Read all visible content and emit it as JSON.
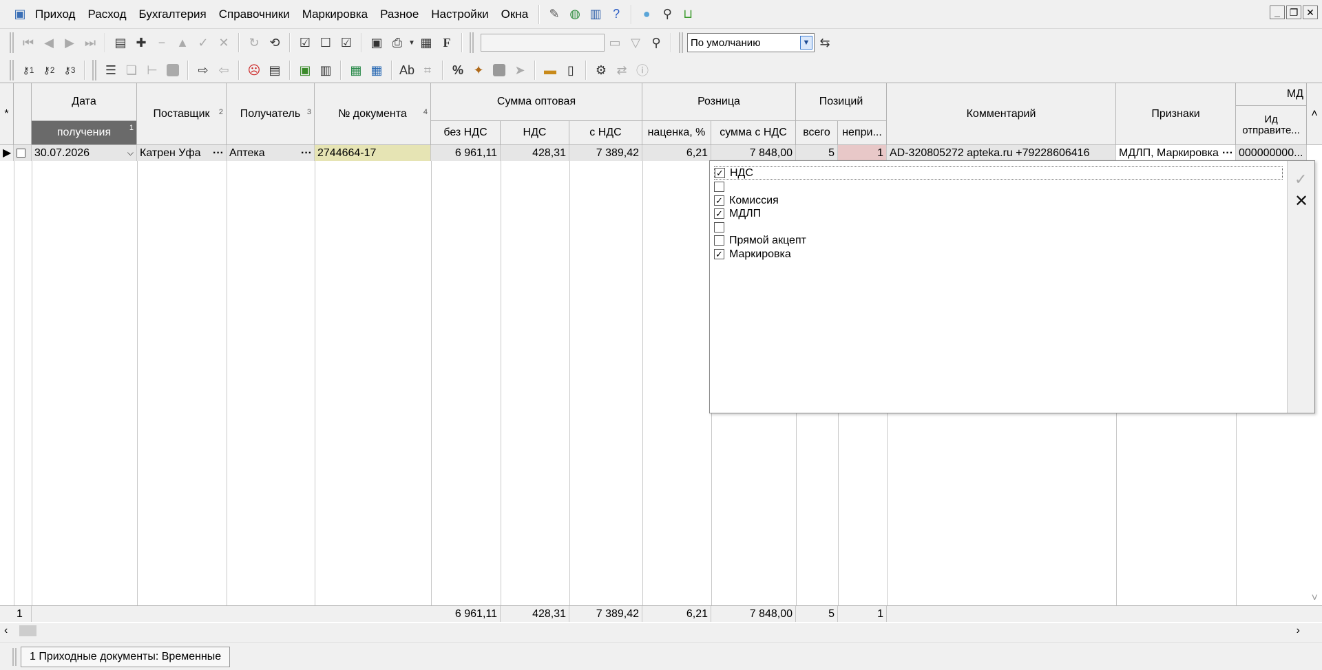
{
  "menu": {
    "items": [
      "Приход",
      "Расход",
      "Бухгалтерия",
      "Справочники",
      "Маркировка",
      "Разное",
      "Настройки",
      "Окна"
    ]
  },
  "toolbar": {
    "combo_value": "По умолчанию",
    "key_labels": [
      "1",
      "2",
      "3"
    ],
    "percent_label": "%",
    "f_label": "F"
  },
  "grid": {
    "headers": {
      "date": "Дата",
      "date_sub": "получения",
      "supplier": "Поставщик",
      "recipient": "Получатель",
      "doc_no": "№ документа",
      "wholesale": "Сумма оптовая",
      "wholesale_no_vat": "без НДС",
      "vat": "НДС",
      "with_vat": "с НДС",
      "retail": "Розница",
      "markup": "наценка, %",
      "retail_sum": "сумма с НДС",
      "positions": "Позиций",
      "pos_total": "всего",
      "pos_unaccepted": "непри...",
      "comment": "Комментарий",
      "signs": "Признаки",
      "md_group": "МД",
      "sender_id": "Ид отправите...",
      "sort_date": "1",
      "sort_supplier": "2",
      "sort_recipient": "3",
      "sort_doc": "4"
    },
    "row": {
      "date": "30.07.2026",
      "supplier": "Катрен Уфа",
      "recipient": "Аптека",
      "doc_no": "2744664-17",
      "no_vat": "6 961,11",
      "vat": "428,31",
      "with_vat": "7 389,42",
      "markup": "6,21",
      "retail_sum": "7 848,00",
      "pos_total": "5",
      "pos_unaccepted": "1",
      "comment": "AD-320805272 apteka.ru +79228606416",
      "signs": "МДЛП, Маркировка",
      "sender_id": "000000000..."
    },
    "footer": {
      "count": "1",
      "no_vat": "6 961,11",
      "vat": "428,31",
      "with_vat": "7 389,42",
      "markup": "6,21",
      "retail_sum": "7 848,00",
      "pos_total": "5",
      "pos_unaccepted": "1"
    }
  },
  "popup": {
    "options": [
      {
        "label": "НДС",
        "checked": true
      },
      {
        "label": "",
        "checked": false
      },
      {
        "label": "Комиссия",
        "checked": true
      },
      {
        "label": "МДЛП",
        "checked": true
      },
      {
        "label": "",
        "checked": false
      },
      {
        "label": "Прямой акцепт",
        "checked": false
      },
      {
        "label": "Маркировка",
        "checked": true
      }
    ],
    "ok_icon": "checkmark-icon",
    "cancel_icon": "close-icon"
  },
  "status": {
    "tab_label": "1 Приходные документы: Временные"
  }
}
